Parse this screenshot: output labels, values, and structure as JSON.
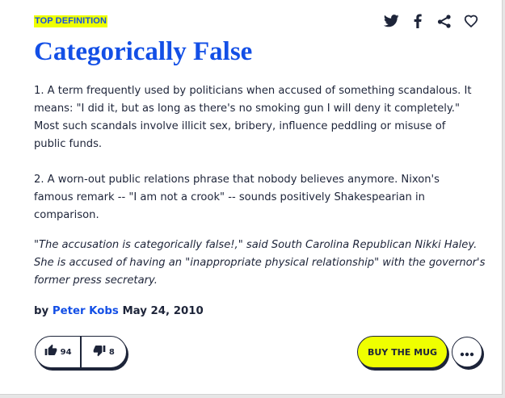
{
  "definition": {
    "badge": "TOP DEFINITION",
    "word": "Categorically False",
    "meaning": [
      "1. A term frequently used by politicians when accused of something scandalous. It means: \"I did it, but as long as there's no smoking gun I will deny it completely.\" Most such scandals involve illicit sex, bribery, influence peddling or misuse of public funds.",
      "2. A worn-out public relations phrase that nobody believes anymore. Nixon's famous remark -- \"I am not a crook\" -- sounds positively Shakespearian in comparison."
    ],
    "example": "\"The accusation is categorically false!,\" said South Carolina Republican Nikki Haley. She is accused of having an \"inappropriate physical relationship\" with the governor's former press secretary.",
    "contributor": {
      "prefix": "by",
      "author": "Peter Kobs",
      "date": "May 24, 2010"
    }
  },
  "share_icons": [
    "twitter-icon",
    "facebook-icon",
    "share-icon",
    "heart-icon"
  ],
  "votes": {
    "up_icon": "thumbs-up-icon",
    "up_count": "94",
    "down_icon": "thumbs-down-icon",
    "down_count": "8"
  },
  "actions": {
    "mug_label": "BUY THE MUG",
    "more_icon": "ellipsis-icon"
  },
  "colors": {
    "accent_blue": "#134fe6",
    "highlight_yellow": "#efff00",
    "text_dark": "#1d2439"
  }
}
